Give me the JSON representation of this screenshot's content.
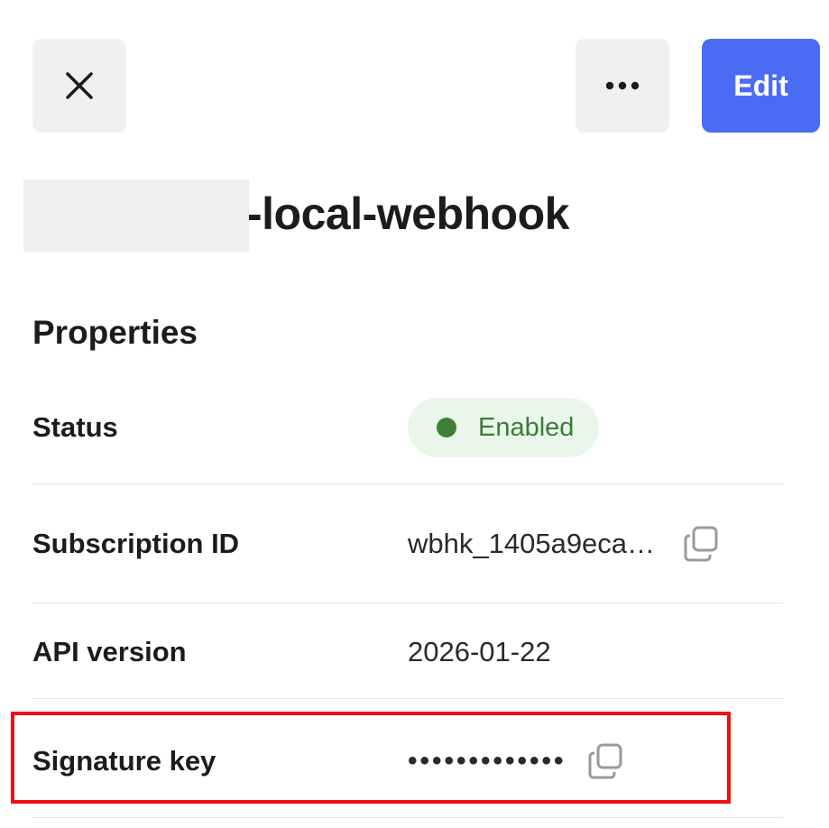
{
  "toolbar": {
    "close_icon": "close-icon",
    "more_icon": "more-horizontal-icon",
    "edit_label": "Edit",
    "edit_color": "#4a6cf5"
  },
  "header": {
    "title_suffix": "-local-webhook"
  },
  "properties": {
    "heading": "Properties",
    "rows": [
      {
        "label": "Status",
        "value": "Enabled"
      },
      {
        "label": "Subscription ID",
        "value": "wbhk_1405a9eca…",
        "copy_icon": "copy-icon"
      },
      {
        "label": "API version",
        "value": "2026-01-22"
      },
      {
        "label": "Signature key",
        "value": "•••••••••••••",
        "copy_icon": "copy-icon"
      }
    ]
  },
  "colors": {
    "status_text": "#3c7a36",
    "status_bg": "#e9f7ea",
    "highlight": "#ee1111"
  }
}
